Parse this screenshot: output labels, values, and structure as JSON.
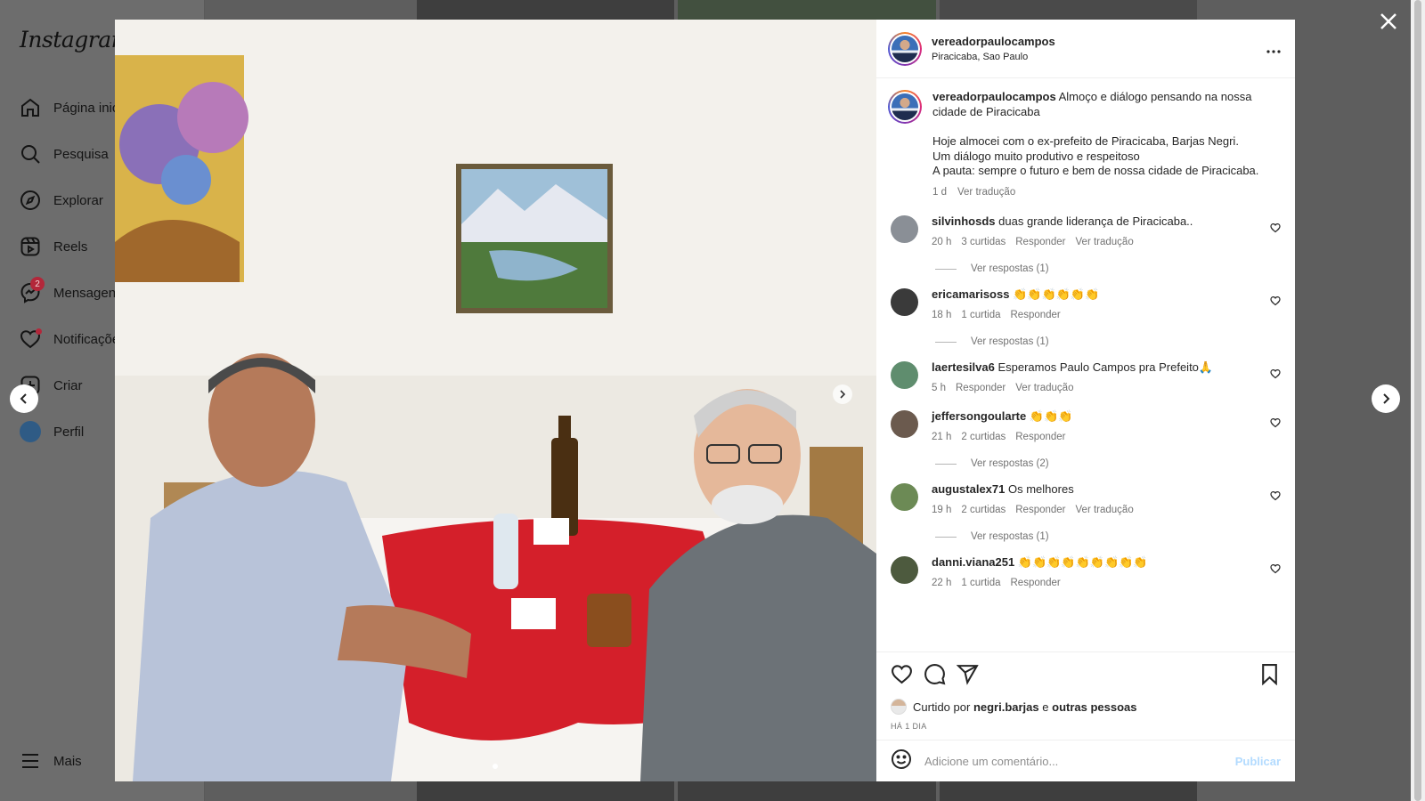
{
  "sidebar": {
    "logo": "Instagram",
    "items": [
      {
        "label": "Página inicial",
        "icon": "home-icon"
      },
      {
        "label": "Pesquisa",
        "icon": "search-icon"
      },
      {
        "label": "Explorar",
        "icon": "compass-icon"
      },
      {
        "label": "Reels",
        "icon": "reels-icon"
      },
      {
        "label": "Mensagens",
        "icon": "messenger-icon",
        "badge": "2"
      },
      {
        "label": "Notificações",
        "icon": "heart-icon"
      },
      {
        "label": "Criar",
        "icon": "plus-square-icon"
      },
      {
        "label": "Perfil",
        "icon": "avatar"
      }
    ],
    "more": "Mais"
  },
  "post": {
    "author": "vereadorpaulocampos",
    "location": "Piracicaba, Sao Paulo",
    "caption_line1": "Almoço e diálogo pensando na nossa cidade de Piracicaba",
    "caption_p1": "Hoje almocei com o ex-prefeito de Piracicaba, Barjas Negri.",
    "caption_p2": "Um diálogo muito produtivo e respeitoso",
    "caption_p3": "A pauta: sempre o futuro e bem de nossa cidade de Piracicaba.",
    "caption_time": "1 d",
    "translate": "Ver tradução",
    "liked_prefix": "Curtido por",
    "liked_user": "negri.barjas",
    "liked_conj": "e",
    "liked_others": "outras pessoas",
    "time_ago": "HÁ 1 DIA",
    "comment_placeholder": "Adicione um comentário...",
    "publish": "Publicar"
  },
  "comments": [
    {
      "user": "silvinhosds",
      "text": "duas grande liderança de Piracicaba..",
      "time": "20 h",
      "likes": "3 curtidas",
      "reply": "Responder",
      "translate": "Ver tradução",
      "replies": "Ver respostas (1)",
      "avatar_color": "#8a8f96"
    },
    {
      "user": "ericamarisoss",
      "text": "👏👏👏👏👏👏",
      "time": "18 h",
      "likes": "1 curtida",
      "reply": "Responder",
      "translate": "",
      "replies": "Ver respostas (1)",
      "avatar_color": "#3a3a3a"
    },
    {
      "user": "laertesilva6",
      "text": "Esperamos Paulo Campos pra Prefeito🙏",
      "time": "5 h",
      "likes": "",
      "reply": "Responder",
      "translate": "Ver tradução",
      "replies": "",
      "avatar_color": "#5f8d6e"
    },
    {
      "user": "jeffersongoularte",
      "text": "👏👏👏",
      "time": "21 h",
      "likes": "2 curtidas",
      "reply": "Responder",
      "translate": "",
      "replies": "Ver respostas (2)",
      "avatar_color": "#6b5a4e"
    },
    {
      "user": "augustalex71",
      "text": "Os melhores",
      "time": "19 h",
      "likes": "2 curtidas",
      "reply": "Responder",
      "translate": "Ver tradução",
      "replies": "Ver respostas (1)",
      "avatar_color": "#6c8a55"
    },
    {
      "user": "danni.viana251",
      "text": "👏👏👏👏👏👏👏👏👏",
      "time": "22 h",
      "likes": "1 curtida",
      "reply": "Responder",
      "translate": "",
      "replies": "",
      "avatar_color": "#4d5a3e"
    }
  ]
}
